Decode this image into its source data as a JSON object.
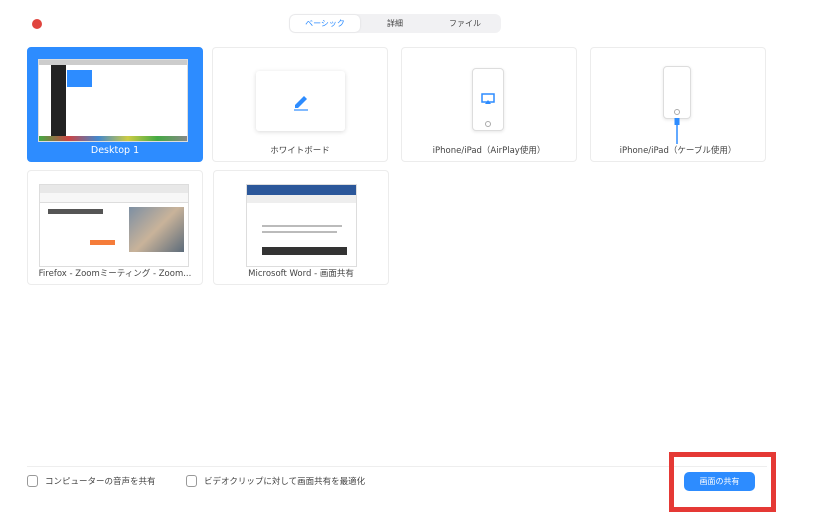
{
  "window": {
    "close_color": "#e0443e"
  },
  "tabs": [
    {
      "label": "ベーシック",
      "active": true
    },
    {
      "label": "詳細",
      "active": false
    },
    {
      "label": "ファイル",
      "active": false
    }
  ],
  "sources": [
    {
      "label": "Desktop 1",
      "selected": true
    },
    {
      "label": "ホワイトボード",
      "icon": "pencil-icon"
    },
    {
      "label": "iPhone/iPad（AirPlay使用）",
      "icon": "airplay-icon"
    },
    {
      "label": "iPhone/iPad（ケーブル使用）",
      "icon": "cable-icon"
    },
    {
      "label": "Firefox - Zoomミーティング - Zoom..."
    },
    {
      "label": "Microsoft Word - 画面共有"
    }
  ],
  "options": {
    "share_audio": "コンピューターの音声を共有",
    "optimize_video": "ビデオクリップに対して画面共有を最適化"
  },
  "share_button": "画面の共有",
  "accent": "#2d8cff",
  "highlight": "#e53935"
}
